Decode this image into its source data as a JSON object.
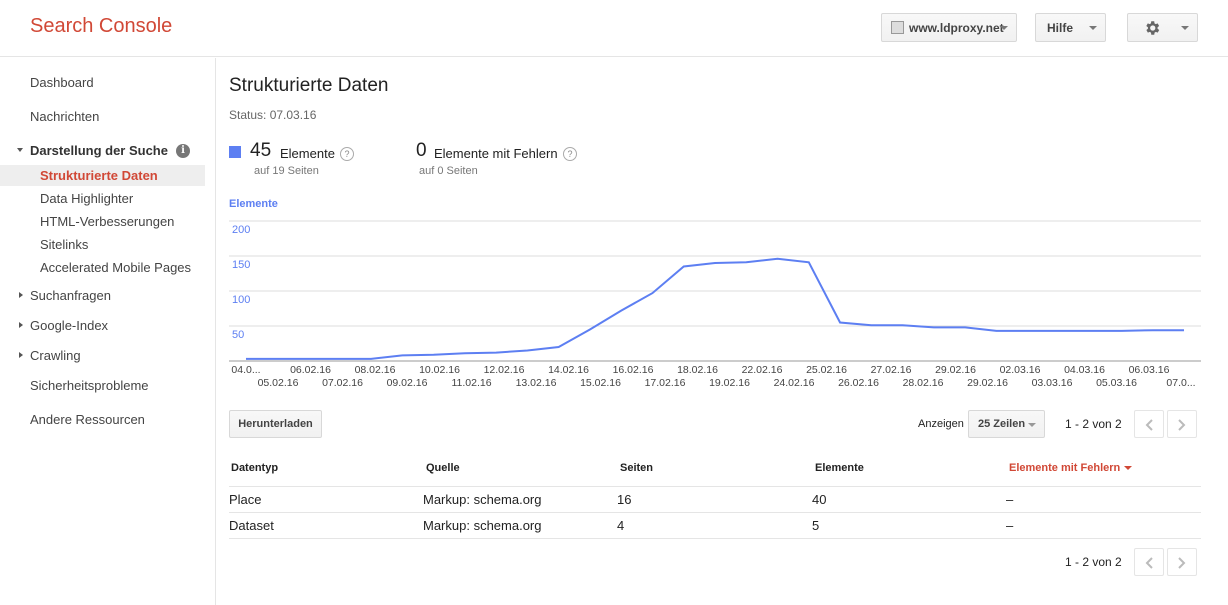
{
  "header": {
    "logo": "Search Console",
    "site": "www.ldproxy.net",
    "help": "Hilfe"
  },
  "sidebar": {
    "dashboard": "Dashboard",
    "messages": "Nachrichten",
    "search_appearance": "Darstellung der Suche",
    "sub_items": [
      "Strukturierte Daten",
      "Data Highlighter",
      "HTML-Verbesserungen",
      "Sitelinks",
      "Accelerated Mobile Pages"
    ],
    "search_traffic": "Suchanfragen",
    "google_index": "Google-Index",
    "crawl": "Crawling",
    "security": "Sicherheitsprobleme",
    "other": "Andere Ressourcen"
  },
  "main": {
    "title": "Strukturierte Daten",
    "status": "Status: 07.03.16",
    "items_count": "45",
    "items_label": "Elemente",
    "items_pages": "auf 19 Seiten",
    "errors_count": "0",
    "errors_label": "Elemente mit Fehlern",
    "errors_pages": "auf 0 Seiten",
    "download": "Herunterladen",
    "show": "Anzeigen",
    "rows": "25 Zeilen",
    "pager": "1 - 2 von 2"
  },
  "table": {
    "headers": [
      "Datentyp",
      "Quelle",
      "Seiten",
      "Elemente",
      "Elemente mit Fehlern"
    ],
    "rows": [
      [
        "Place",
        "Markup: schema.org",
        "16",
        "40",
        "–"
      ],
      [
        "Dataset",
        "Markup: schema.org",
        "4",
        "5",
        "–"
      ]
    ]
  },
  "colors": {
    "accent": "#d14836",
    "series": "#5d7ff2"
  },
  "chart_data": {
    "type": "line",
    "title": "",
    "ylabel": "Elemente",
    "ylim": [
      0,
      200
    ],
    "yticks": [
      50,
      100,
      150,
      200
    ],
    "x_top": [
      "04.0...",
      "06.02.16",
      "08.02.16",
      "10.02.16",
      "12.02.16",
      "14.02.16",
      "16.02.16",
      "18.02.16",
      "22.02.16",
      "25.02.16",
      "27.02.16",
      "29.02.16",
      "02.03.16",
      "04.03.16",
      "06.03.16"
    ],
    "x_bottom": [
      "05.02.16",
      "07.02.16",
      "09.02.16",
      "11.02.16",
      "13.02.16",
      "15.02.16",
      "17.02.16",
      "19.02.16",
      "24.02.16",
      "26.02.16",
      "28.02.16",
      "29.02.16",
      "03.03.16",
      "05.03.16",
      "07.0..."
    ],
    "series": [
      {
        "values": [
          3,
          3,
          3,
          3,
          3,
          8,
          9,
          11,
          12,
          15,
          20,
          45,
          72,
          97,
          135,
          140,
          141,
          146,
          141,
          55,
          51,
          51,
          48,
          48,
          43,
          43,
          43,
          43,
          43,
          44,
          44
        ]
      }
    ]
  }
}
